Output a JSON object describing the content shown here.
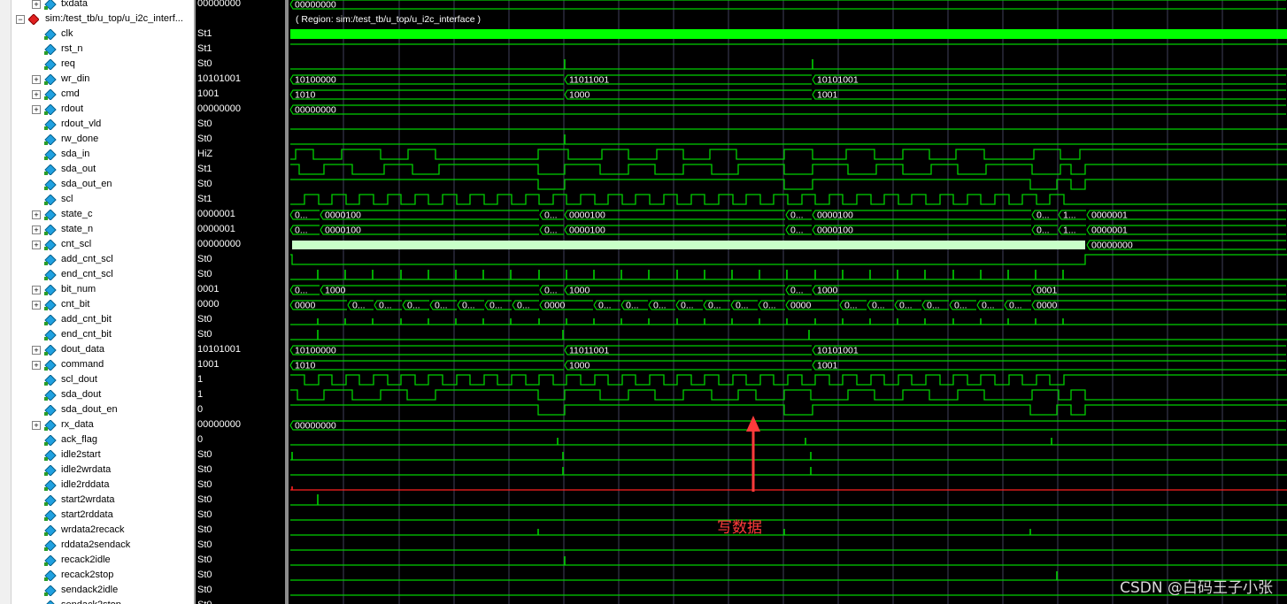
{
  "region_label": "( Region: sim:/test_tb/u_top/u_i2c_interface )",
  "annotation_text": "写数据",
  "watermark_text": "CSDN @白码王子小张",
  "colors": {
    "wave": "#00d000",
    "bright": "#00ff00",
    "z": "#0000e0",
    "x": "#ff2020",
    "grid": "#40405a",
    "arrow": "#ff3b3b"
  },
  "signals": [
    {
      "name": "txdata",
      "value": "00000000",
      "bus": true
    },
    {
      "name": "sim:/test_tb/u_top/u_i2c_interf...",
      "value": "",
      "group": true
    },
    {
      "name": "clk",
      "value": "St1"
    },
    {
      "name": "rst_n",
      "value": "St1"
    },
    {
      "name": "req",
      "value": "St0"
    },
    {
      "name": "wr_din",
      "value": "10101001",
      "bus": true
    },
    {
      "name": "cmd",
      "value": "1001",
      "bus": true
    },
    {
      "name": "rdout",
      "value": "00000000",
      "bus": true
    },
    {
      "name": "rdout_vld",
      "value": "St0"
    },
    {
      "name": "rw_done",
      "value": "St0"
    },
    {
      "name": "sda_in",
      "value": "HiZ"
    },
    {
      "name": "sda_out",
      "value": "St1"
    },
    {
      "name": "sda_out_en",
      "value": "St0"
    },
    {
      "name": "scl",
      "value": "St1"
    },
    {
      "name": "state_c",
      "value": "0000001",
      "bus": true
    },
    {
      "name": "state_n",
      "value": "0000001",
      "bus": true
    },
    {
      "name": "cnt_scl",
      "value": "00000000",
      "bus": true
    },
    {
      "name": "add_cnt_scl",
      "value": "St0"
    },
    {
      "name": "end_cnt_scl",
      "value": "St0"
    },
    {
      "name": "bit_num",
      "value": "0001",
      "bus": true
    },
    {
      "name": "cnt_bit",
      "value": "0000",
      "bus": true
    },
    {
      "name": "add_cnt_bit",
      "value": "St0"
    },
    {
      "name": "end_cnt_bit",
      "value": "St0"
    },
    {
      "name": "dout_data",
      "value": "10101001",
      "bus": true
    },
    {
      "name": "command",
      "value": "1001",
      "bus": true
    },
    {
      "name": "scl_dout",
      "value": "1"
    },
    {
      "name": "sda_dout",
      "value": "1"
    },
    {
      "name": "sda_dout_en",
      "value": "0"
    },
    {
      "name": "rx_data",
      "value": "00000000",
      "bus": true
    },
    {
      "name": "ack_flag",
      "value": "0"
    },
    {
      "name": "idle2start",
      "value": "St0"
    },
    {
      "name": "idle2wrdata",
      "value": "St0"
    },
    {
      "name": "idle2rddata",
      "value": "St0"
    },
    {
      "name": "start2wrdata",
      "value": "St0"
    },
    {
      "name": "start2rddata",
      "value": "St0"
    },
    {
      "name": "wrdata2recack",
      "value": "St0"
    },
    {
      "name": "rddata2sendack",
      "value": "St0"
    },
    {
      "name": "recack2idle",
      "value": "St0"
    },
    {
      "name": "recack2stop",
      "value": "St0"
    },
    {
      "name": "sendack2idle",
      "value": "St0"
    },
    {
      "name": "sendack2stop",
      "value": "St0"
    }
  ],
  "bus_labels": {
    "txdata": [
      [
        "00000000",
        0
      ]
    ],
    "wr_din": [
      [
        "10100000",
        0
      ],
      [
        "11011001",
        310
      ],
      [
        "10101001",
        590
      ]
    ],
    "cmd": [
      [
        "1010",
        0
      ],
      [
        "1000",
        310
      ],
      [
        "1001",
        590
      ]
    ],
    "rdout": [
      [
        "00000000",
        0
      ]
    ],
    "state_c": [
      [
        "0...",
        0
      ],
      [
        "0000100",
        34
      ],
      [
        "0...",
        282
      ],
      [
        "0000100",
        310
      ],
      [
        "0...",
        560
      ],
      [
        "0000100",
        590
      ],
      [
        "0...",
        838
      ],
      [
        "1...",
        868
      ],
      [
        "0000001",
        900
      ]
    ],
    "state_n": [
      [
        "0...",
        0
      ],
      [
        "0000100",
        34
      ],
      [
        "0...",
        282
      ],
      [
        "0000100",
        310
      ],
      [
        "0...",
        560
      ],
      [
        "0000100",
        590
      ],
      [
        "0...",
        838
      ],
      [
        "1...",
        868
      ],
      [
        "0000001",
        900
      ]
    ],
    "cnt_scl": [
      [
        "00000000",
        900
      ]
    ],
    "bit_num": [
      [
        "0...",
        0
      ],
      [
        "1000",
        34
      ],
      [
        "0...",
        282
      ],
      [
        "1000",
        310
      ],
      [
        "0...",
        560
      ],
      [
        "1000",
        590
      ],
      [
        "0001",
        838
      ]
    ],
    "cnt_bit": [
      [
        "0000",
        0
      ],
      [
        "0...",
        65
      ],
      [
        "0...",
        95
      ],
      [
        "0...",
        127
      ],
      [
        "0...",
        158
      ],
      [
        "0...",
        189
      ],
      [
        "0...",
        220
      ],
      [
        "0...",
        251
      ],
      [
        "0000",
        282
      ],
      [
        "0...",
        343
      ],
      [
        "0...",
        374
      ],
      [
        "0...",
        405
      ],
      [
        "0...",
        436
      ],
      [
        "0...",
        467
      ],
      [
        "0...",
        498
      ],
      [
        "0...",
        529
      ],
      [
        "0000",
        560
      ],
      [
        "0...",
        621
      ],
      [
        "0...",
        652
      ],
      [
        "0...",
        683
      ],
      [
        "0...",
        714
      ],
      [
        "0...",
        745
      ],
      [
        "0...",
        776
      ],
      [
        "0...",
        807
      ],
      [
        "0000",
        838
      ]
    ],
    "dout_data": [
      [
        "10100000",
        0
      ],
      [
        "11011001",
        310
      ],
      [
        "10101001",
        590
      ]
    ],
    "command": [
      [
        "1010",
        0
      ],
      [
        "1000",
        310
      ],
      [
        "1001",
        590
      ]
    ],
    "rx_data": [
      [
        "00000000",
        0
      ]
    ]
  }
}
